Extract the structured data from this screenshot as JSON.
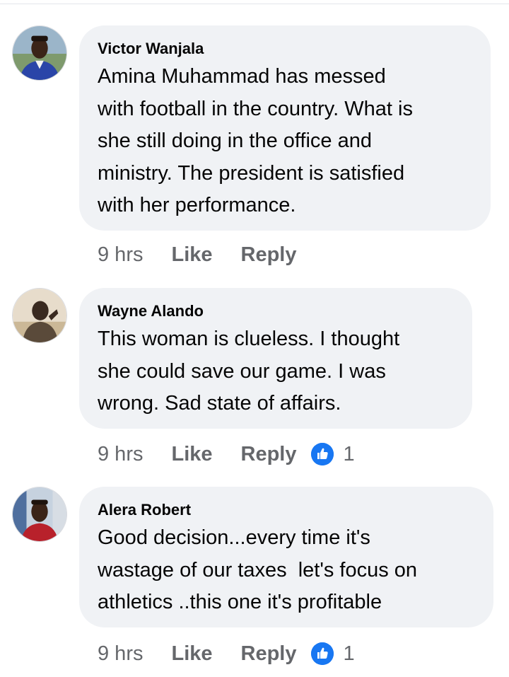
{
  "comments": [
    {
      "author": "Victor Wanjala",
      "text": "Amina Muhammad has messed\nwith football in the country. What is\nshe still doing in the office and\nministry. The president is satisfied\nwith her performance.",
      "time": "9 hrs",
      "like_label": "Like",
      "reply_label": "Reply",
      "reaction_count": "",
      "avatar_icon": "person-avatar"
    },
    {
      "author": "Wayne Alando",
      "text": "This woman is clueless. I thought\nshe could save our game. I was\nwrong. Sad state of affairs.",
      "time": "9 hrs",
      "like_label": "Like",
      "reply_label": "Reply",
      "reaction_count": "1",
      "avatar_icon": "person-avatar"
    },
    {
      "author": "Alera Robert",
      "text": "Good decision...every time it's\nwastage of our taxes  let's focus on\nathletics ..this one it's profitable",
      "time": "9 hrs",
      "like_label": "Like",
      "reply_label": "Reply",
      "reaction_count": "1",
      "avatar_icon": "person-avatar"
    }
  ],
  "colors": {
    "bubble": "#f0f2f5",
    "meta": "#65676b",
    "like_blue": "#1877f2"
  }
}
